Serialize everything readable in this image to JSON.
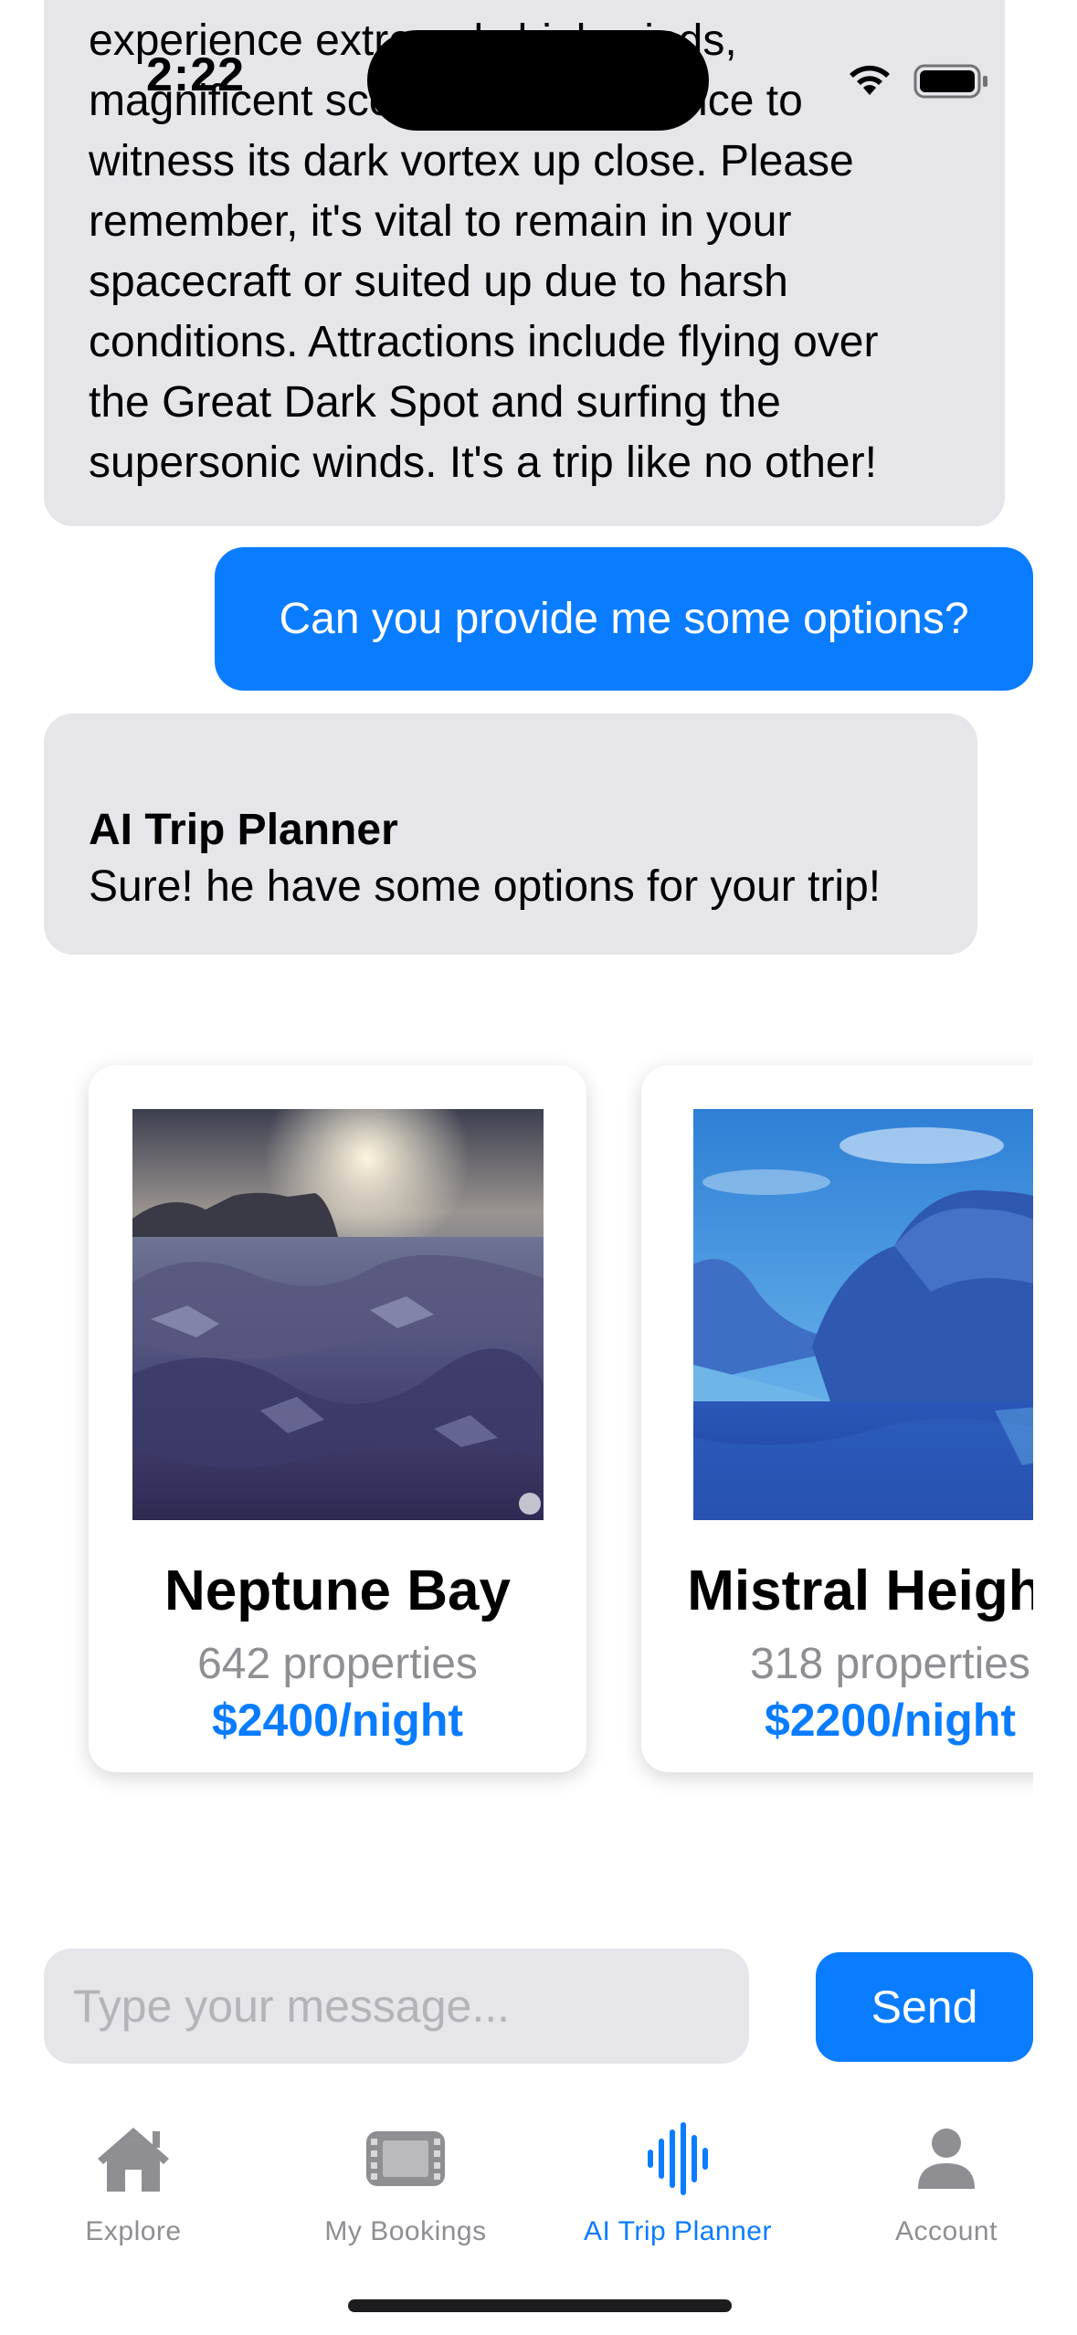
{
  "status_bar": {
    "time": "2:22"
  },
  "chat": {
    "previous_reply": "experience extremely high winds,\nmagnificent scenery and a chance to\nwitness its dark vortex up close. Please\nremember, it's vital to remain in your\nspacecraft or suited up due to harsh\nconditions. Attractions include flying over\nthe Great Dark Spot and surfing the\nsupersonic winds. It's a trip like no other!",
    "user_message": "Can you provide me some options?",
    "ai_sender": "AI Trip Planner",
    "ai_message": "Sure! he have some options for your trip!"
  },
  "options": [
    {
      "name": "Neptune Bay",
      "properties": "642 properties",
      "price": "$2400/night"
    },
    {
      "name": "Mistral Heights",
      "properties": "318 properties",
      "price": "$2200/night"
    }
  ],
  "composer": {
    "placeholder": "Type your message...",
    "send_label": "Send"
  },
  "tab_bar": {
    "explore": "Explore",
    "bookings": "My Bookings",
    "planner": "AI Trip Planner",
    "account": "Account"
  },
  "colors": {
    "accent": "#0a7cff",
    "bubble_gray": "#e5e5ea",
    "inactive": "#8e8e93"
  },
  "icons": {
    "explore": "house-icon",
    "bookings": "film-icon",
    "planner": "waveform-icon",
    "account": "person-icon"
  }
}
